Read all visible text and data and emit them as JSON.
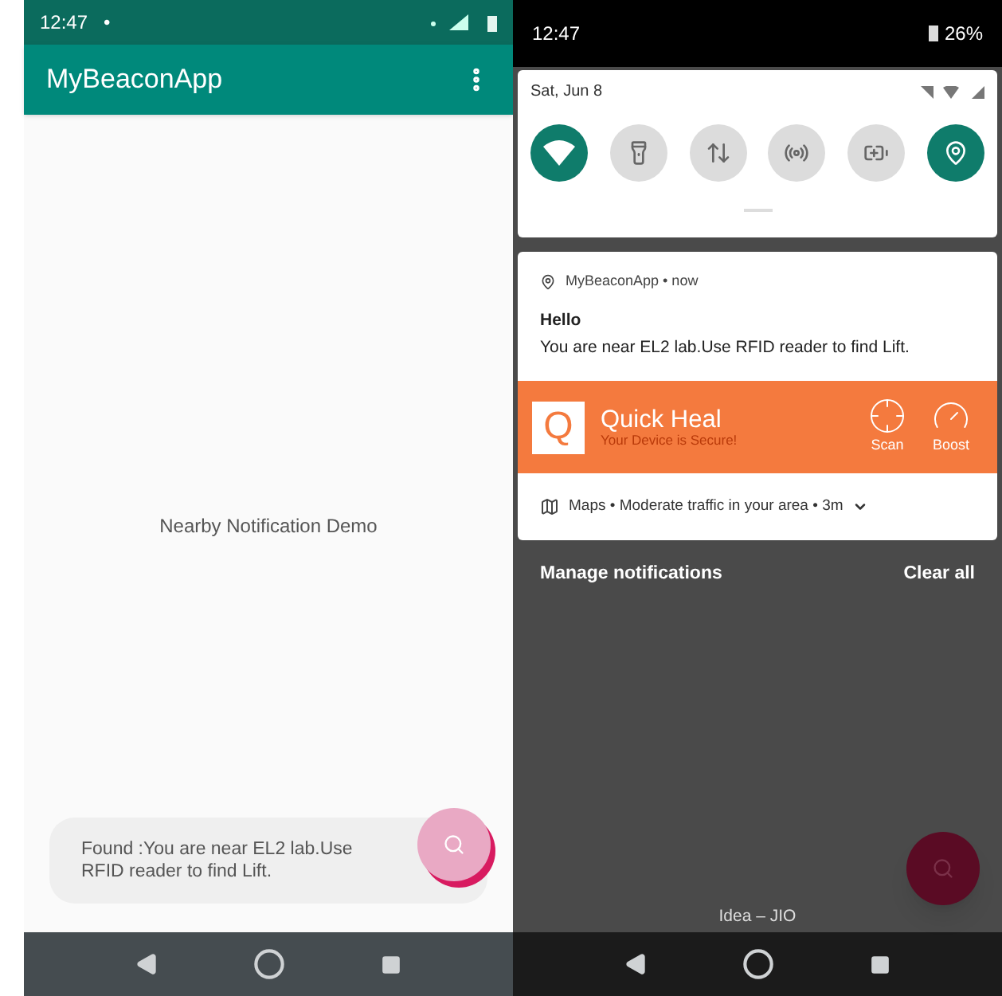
{
  "app_screen": {
    "status_bar": {
      "time": "12:47",
      "dot": "•"
    },
    "app_bar": {
      "title": "MyBeaconApp"
    },
    "body_text": "Nearby Notification Demo",
    "snackbar": {
      "text": "Found  :You are near EL2 lab.Use RFID reader  to find Lift."
    }
  },
  "shade_screen": {
    "status_bar": {
      "time": "12:47",
      "battery": "26%"
    },
    "date": "Sat, Jun 8",
    "tiles": [
      {
        "kind": "wifi",
        "on": true
      },
      {
        "kind": "flashlight",
        "on": false
      },
      {
        "kind": "data",
        "on": false
      },
      {
        "kind": "hotspot",
        "on": false
      },
      {
        "kind": "battery",
        "on": false
      },
      {
        "kind": "location",
        "on": true
      }
    ],
    "notification": {
      "app": "MyBeaconApp • now",
      "title": "Hello",
      "body": "You are near EL2 lab.Use RFID reader  to find Lift."
    },
    "quick_heal": {
      "logo": "Q",
      "title": "Quick Heal",
      "subtitle": "Your Device is Secure!",
      "actions": [
        "Scan",
        "Boost"
      ]
    },
    "maps_row": {
      "text": "Maps • Moderate traffic in your area • 3m"
    },
    "footer": {
      "manage": "Manage notifications",
      "clear": "Clear all"
    },
    "carrier": "Idea – JIO"
  }
}
